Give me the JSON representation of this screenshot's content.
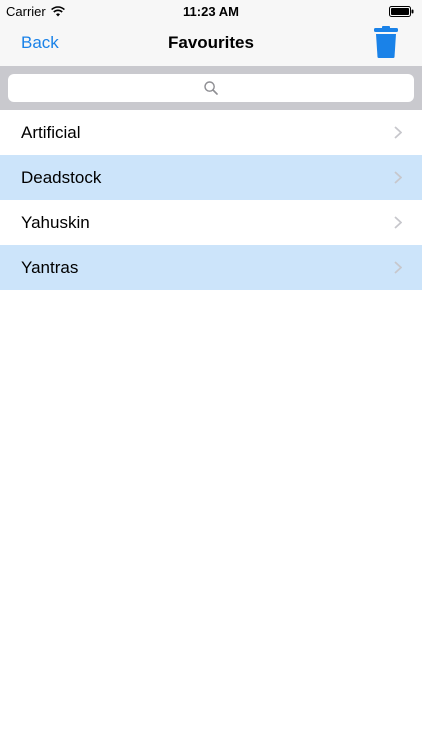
{
  "status": {
    "carrier": "Carrier",
    "time": "11:23 AM"
  },
  "nav": {
    "back_label": "Back",
    "title": "Favourites",
    "action_icon": "trash-icon",
    "accent_color": "#1a82e8"
  },
  "search": {
    "placeholder": "",
    "value": "",
    "icon": "search-icon"
  },
  "list": {
    "items": [
      {
        "label": "Artificial",
        "highlighted": false
      },
      {
        "label": "Deadstock",
        "highlighted": true
      },
      {
        "label": "Yahuskin",
        "highlighted": false
      },
      {
        "label": "Yantras",
        "highlighted": true
      }
    ],
    "highlight_color": "#cce4fa",
    "disclosure_icon": "chevron-right-icon"
  }
}
